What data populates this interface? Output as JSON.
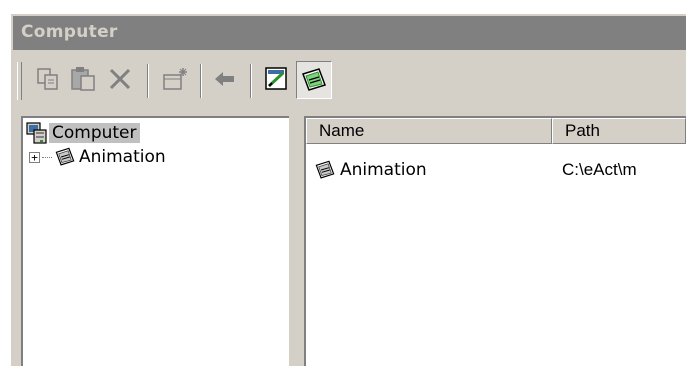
{
  "window": {
    "title": "Computer"
  },
  "toolbar": {
    "buttons": [
      {
        "name": "copy",
        "icon": "copy-icon",
        "enabled": false
      },
      {
        "name": "paste",
        "icon": "paste-icon",
        "enabled": false
      },
      {
        "name": "delete",
        "icon": "delete-icon",
        "enabled": false
      },
      {
        "name": "new",
        "icon": "new-item-icon",
        "enabled": false
      },
      {
        "name": "back",
        "icon": "back-arrow-icon",
        "enabled": false
      },
      {
        "name": "edit",
        "icon": "edit-icon",
        "enabled": true
      },
      {
        "name": "animation-view",
        "icon": "animation-icon",
        "enabled": true,
        "pressed": true
      }
    ]
  },
  "tree": {
    "root": {
      "label": "Computer",
      "icon": "computer-icon",
      "selected": true
    },
    "children": [
      {
        "label": "Animation",
        "icon": "animation-icon",
        "expander": "+"
      }
    ]
  },
  "list": {
    "columns": [
      "Name",
      "Path"
    ],
    "rows": [
      {
        "name": "Animation",
        "path": "C:\\eAct\\m",
        "icon": "animation-icon"
      }
    ]
  },
  "colors": {
    "face": "#d4d0c8",
    "titlebar": "#808080",
    "selection": "#c0c0c0",
    "accent_green": "#2f8f2f",
    "accent_blue": "#3a6ea5"
  }
}
